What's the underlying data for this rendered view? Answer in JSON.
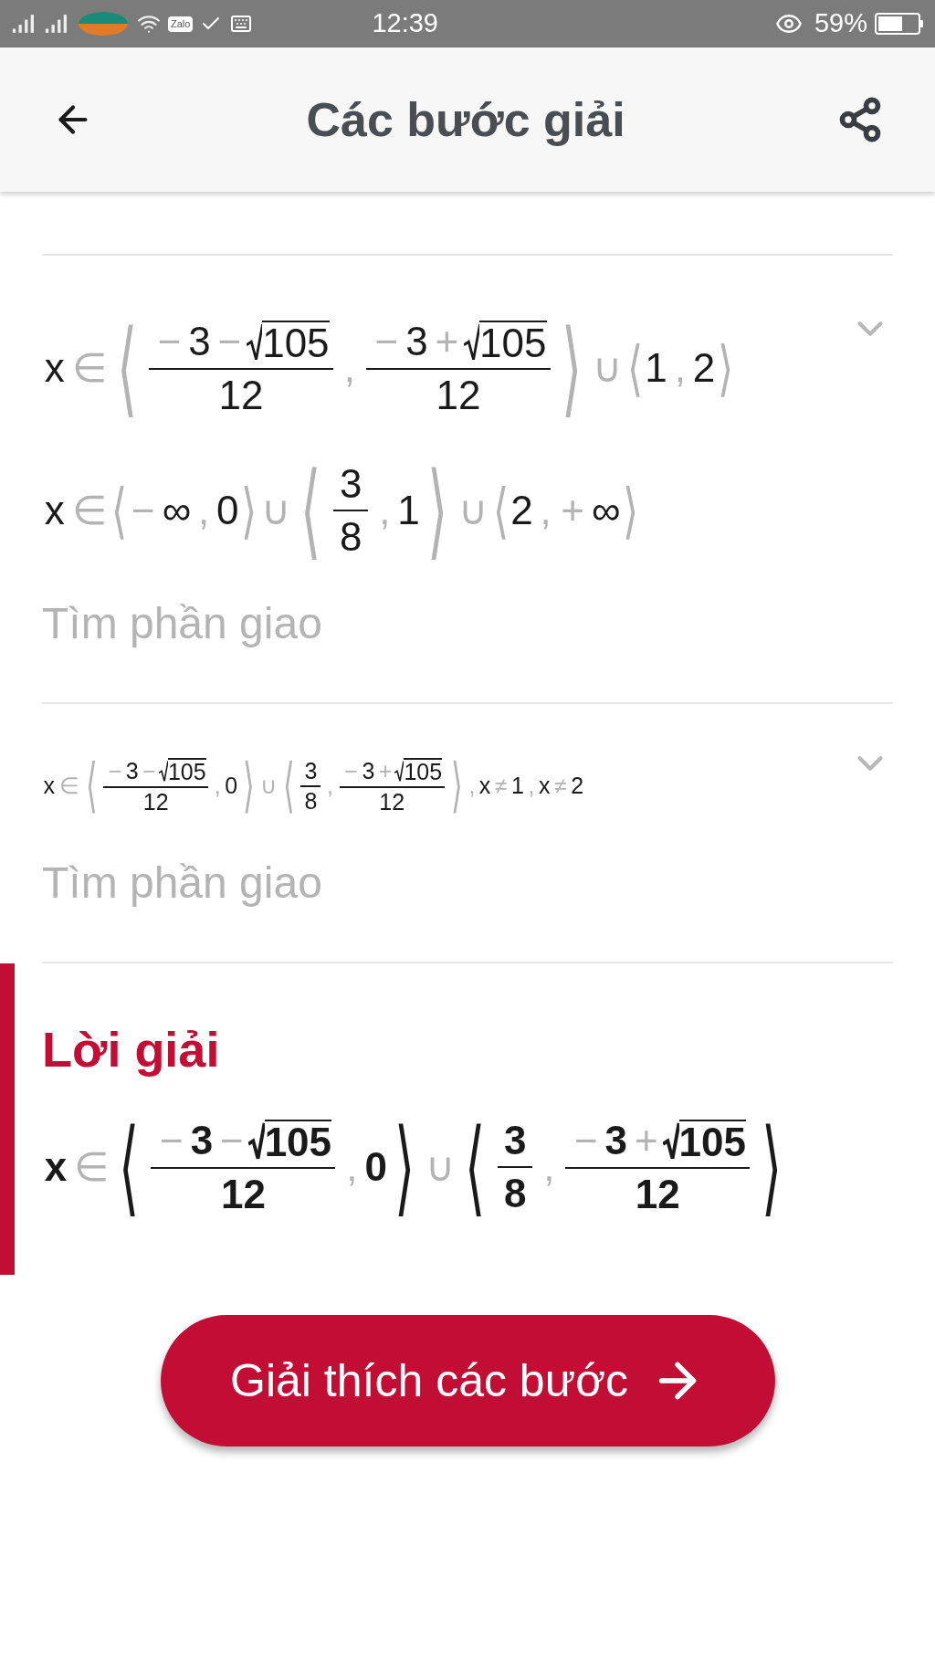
{
  "status_bar": {
    "app_badge": "Zalo",
    "time": "12:39",
    "battery": "59%"
  },
  "header": {
    "title": "Các bước giải"
  },
  "steps": [
    {
      "expressions": [
        [
          {
            "kind": "num",
            "text": "x"
          },
          {
            "kind": "op",
            "text": "∈"
          },
          {
            "kind": "interval",
            "open": "⟨",
            "close": "⟩",
            "items": [
              {
                "kind": "frac",
                "num": [
                  {
                    "kind": "op",
                    "text": "−"
                  },
                  {
                    "kind": "num",
                    "text": "3"
                  },
                  {
                    "kind": "op",
                    "text": "−"
                  },
                  {
                    "kind": "sqrt",
                    "text": "105"
                  }
                ],
                "den": [
                  {
                    "kind": "num",
                    "text": "12"
                  }
                ]
              },
              {
                "kind": "op",
                "text": ","
              },
              {
                "kind": "frac",
                "num": [
                  {
                    "kind": "op",
                    "text": "−"
                  },
                  {
                    "kind": "num",
                    "text": "3"
                  },
                  {
                    "kind": "op",
                    "text": "+"
                  },
                  {
                    "kind": "sqrt",
                    "text": "105"
                  }
                ],
                "den": [
                  {
                    "kind": "num",
                    "text": "12"
                  }
                ]
              }
            ]
          },
          {
            "kind": "op",
            "text": "∪"
          },
          {
            "kind": "interval",
            "open": "⟨",
            "close": "⟩",
            "items": [
              {
                "kind": "num",
                "text": "1"
              },
              {
                "kind": "op",
                "text": ","
              },
              {
                "kind": "num",
                "text": "2"
              }
            ]
          }
        ],
        [
          {
            "kind": "num",
            "text": "x"
          },
          {
            "kind": "op",
            "text": "∈"
          },
          {
            "kind": "interval",
            "open": "⟨",
            "close": "⟩",
            "items": [
              {
                "kind": "op",
                "text": "−"
              },
              {
                "kind": "num",
                "text": "∞"
              },
              {
                "kind": "op",
                "text": ","
              },
              {
                "kind": "num",
                "text": "0"
              }
            ]
          },
          {
            "kind": "op",
            "text": "∪"
          },
          {
            "kind": "interval",
            "open": "⟨",
            "close": "⟩",
            "items": [
              {
                "kind": "frac",
                "num": [
                  {
                    "kind": "num",
                    "text": "3"
                  }
                ],
                "den": [
                  {
                    "kind": "num",
                    "text": "8"
                  }
                ]
              },
              {
                "kind": "op",
                "text": ","
              },
              {
                "kind": "num",
                "text": "1"
              }
            ]
          },
          {
            "kind": "op",
            "text": "∪"
          },
          {
            "kind": "interval",
            "open": "⟨",
            "close": "⟩",
            "items": [
              {
                "kind": "num",
                "text": "2"
              },
              {
                "kind": "op",
                "text": ","
              },
              {
                "kind": "op",
                "text": "+"
              },
              {
                "kind": "num",
                "text": "∞"
              }
            ]
          }
        ]
      ],
      "caption": "Tìm phần giao"
    },
    {
      "expressions": [
        [
          {
            "kind": "num",
            "text": "x"
          },
          {
            "kind": "op",
            "text": "∈"
          },
          {
            "kind": "interval",
            "open": "⟨",
            "close": "⟩",
            "items": [
              {
                "kind": "frac",
                "num": [
                  {
                    "kind": "op",
                    "text": "−"
                  },
                  {
                    "kind": "num",
                    "text": "3"
                  },
                  {
                    "kind": "op",
                    "text": "−"
                  },
                  {
                    "kind": "sqrt",
                    "text": "105"
                  }
                ],
                "den": [
                  {
                    "kind": "num",
                    "text": "12"
                  }
                ]
              },
              {
                "kind": "op",
                "text": ","
              },
              {
                "kind": "num",
                "text": "0"
              }
            ]
          },
          {
            "kind": "op",
            "text": "∪"
          },
          {
            "kind": "interval",
            "open": "⟨",
            "close": "⟩",
            "items": [
              {
                "kind": "frac",
                "num": [
                  {
                    "kind": "num",
                    "text": "3"
                  }
                ],
                "den": [
                  {
                    "kind": "num",
                    "text": "8"
                  }
                ]
              },
              {
                "kind": "op",
                "text": ","
              },
              {
                "kind": "frac",
                "num": [
                  {
                    "kind": "op",
                    "text": "−"
                  },
                  {
                    "kind": "num",
                    "text": "3"
                  },
                  {
                    "kind": "op",
                    "text": "+"
                  },
                  {
                    "kind": "sqrt",
                    "text": "105"
                  }
                ],
                "den": [
                  {
                    "kind": "num",
                    "text": "12"
                  }
                ]
              }
            ]
          },
          {
            "kind": "op",
            "text": ","
          },
          {
            "kind": "num",
            "text": "x"
          },
          {
            "kind": "op",
            "text": "≠"
          },
          {
            "kind": "num",
            "text": "1"
          },
          {
            "kind": "op",
            "text": ","
          },
          {
            "kind": "num",
            "text": "x"
          },
          {
            "kind": "op",
            "text": "≠"
          },
          {
            "kind": "num",
            "text": "2"
          }
        ]
      ],
      "caption": "Tìm phần giao"
    }
  ],
  "solution": {
    "title": "Lời giải",
    "expression": [
      {
        "kind": "num",
        "text": "x"
      },
      {
        "kind": "op",
        "text": "∈"
      },
      {
        "kind": "interval",
        "open": "⟨",
        "close": "⟩",
        "items": [
          {
            "kind": "frac",
            "num": [
              {
                "kind": "op",
                "text": "−"
              },
              {
                "kind": "num",
                "text": "3"
              },
              {
                "kind": "op",
                "text": "−"
              },
              {
                "kind": "sqrt",
                "text": "105"
              }
            ],
            "den": [
              {
                "kind": "num",
                "text": "12"
              }
            ]
          },
          {
            "kind": "op",
            "text": ","
          },
          {
            "kind": "num",
            "text": "0"
          }
        ]
      },
      {
        "kind": "op",
        "text": "∪"
      },
      {
        "kind": "interval",
        "open": "⟨",
        "close": "⟩",
        "items": [
          {
            "kind": "frac",
            "num": [
              {
                "kind": "num",
                "text": "3"
              }
            ],
            "den": [
              {
                "kind": "num",
                "text": "8"
              }
            ]
          },
          {
            "kind": "op",
            "text": ","
          },
          {
            "kind": "frac",
            "num": [
              {
                "kind": "op",
                "text": "−"
              },
              {
                "kind": "num",
                "text": "3"
              },
              {
                "kind": "op",
                "text": "+"
              },
              {
                "kind": "sqrt",
                "text": "105"
              }
            ],
            "den": [
              {
                "kind": "num",
                "text": "12"
              }
            ]
          }
        ]
      }
    ]
  },
  "action_button": {
    "label": "Giải thích các bước"
  }
}
